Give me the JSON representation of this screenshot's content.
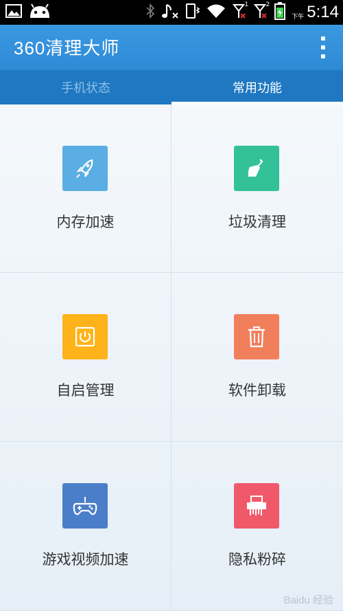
{
  "status_bar": {
    "time": "5:14",
    "ampm": "下午",
    "sim1": "1",
    "sim2": "2",
    "icons": [
      "image-icon",
      "android-icon",
      "bluetooth-icon",
      "music-mute-icon",
      "vibrate-icon",
      "wifi-icon",
      "signal-icon",
      "signal-icon",
      "battery-icon"
    ]
  },
  "app_bar": {
    "title": "360清理大师",
    "menu_icon": "overflow-menu-icon"
  },
  "tabs": [
    {
      "label": "手机状态",
      "active": false
    },
    {
      "label": "常用功能",
      "active": true
    }
  ],
  "features": [
    {
      "label": "内存加速",
      "icon": "rocket-icon",
      "color": "#5aaee3"
    },
    {
      "label": "垃圾清理",
      "icon": "broom-icon",
      "color": "#32c199"
    },
    {
      "label": "自启管理",
      "icon": "power-icon",
      "color": "#ffb31a"
    },
    {
      "label": "软件卸载",
      "icon": "trash-icon",
      "color": "#f17f5b"
    },
    {
      "label": "游戏视频加速",
      "icon": "gamepad-icon",
      "color": "#4a7ec9"
    },
    {
      "label": "隐私粉碎",
      "icon": "shredder-icon",
      "color": "#f0596a"
    }
  ],
  "watermark": "Baidu 经验"
}
